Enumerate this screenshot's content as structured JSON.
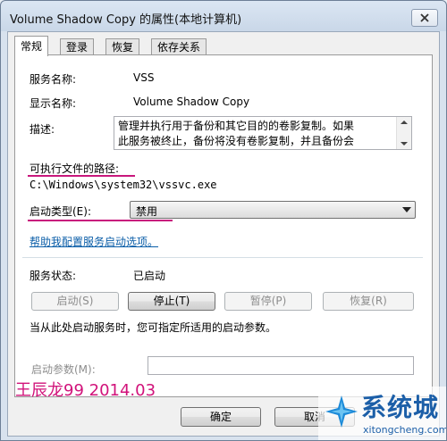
{
  "window": {
    "title": "Volume Shadow Copy 的属性(本地计算机)"
  },
  "tabs": [
    {
      "label": "常规"
    },
    {
      "label": "登录"
    },
    {
      "label": "恢复"
    },
    {
      "label": "依存关系"
    }
  ],
  "general": {
    "service_name_label": "服务名称:",
    "service_name_value": "VSS",
    "display_name_label": "显示名称:",
    "display_name_value": "Volume Shadow Copy",
    "description_label": "描述:",
    "description_line1": "管理并执行用于备份和其它目的的卷影复制。如果",
    "description_line2": "此服务被终止，备份将没有卷影复制，并且备份会",
    "exe_path_label": "可执行文件的路径:",
    "exe_path_value": "C:\\Windows\\system32\\vssvc.exe",
    "startup_type_label": "启动类型(E):",
    "startup_type_value": "禁用",
    "help_link": "帮助我配置服务启动选项。",
    "status_label": "服务状态:",
    "status_value": "已启动",
    "start_label": "启动(S)",
    "stop_label": "停止(T)",
    "pause_label": "暂停(P)",
    "resume_label": "恢复(R)",
    "hint_text": "当从此处启动服务时，您可指定所适用的启动参数。",
    "params_label": "启动参数(M):"
  },
  "footer": {
    "ok_label": "确定",
    "cancel_label": "取消",
    "signature": "王辰龙99 2014.03",
    "watermark_logo": "系统城",
    "watermark_url": "xitongcheng.com"
  },
  "colors": {
    "annotation_underline": "#c8177c",
    "link": "#0b5ea8",
    "signature": "#d1127a",
    "logo": "#1c5fa8"
  }
}
